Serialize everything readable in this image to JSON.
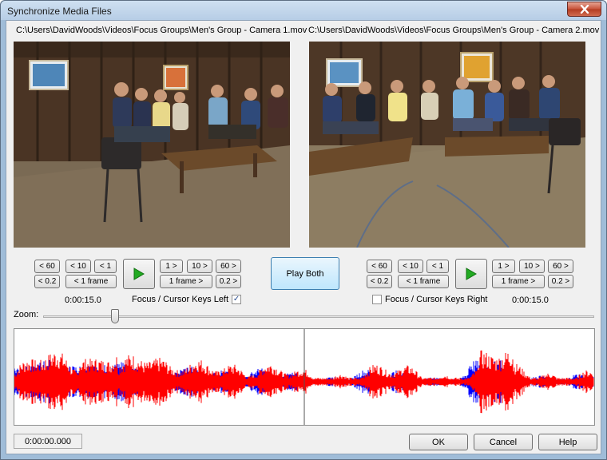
{
  "window": {
    "title": "Synchronize Media Files"
  },
  "left": {
    "path": "C:\\Users\\DavidWoods\\Videos\\Focus Groups\\Men's Group - Camera 1.mov",
    "buttons": [
      "< 60",
      "< 10",
      "< 1",
      "1 >",
      "10 >",
      "60 >",
      "< 0.2",
      "< 1 frame",
      "1 frame >",
      "0.2 >"
    ],
    "time": "0:00:15.0",
    "focus_label": "Focus / Cursor Keys Left",
    "focus_checked": true
  },
  "right": {
    "path": "C:\\Users\\DavidWoods\\Videos\\Focus Groups\\Men's Group - Camera 2.mov",
    "buttons": [
      "< 60",
      "< 10",
      "< 1",
      "1 >",
      "10 >",
      "60 >",
      "< 0.2",
      "< 1 frame",
      "1 frame >",
      "0.2 >"
    ],
    "time": "0:00:15.0",
    "focus_label": "Focus / Cursor Keys Right",
    "focus_checked": false
  },
  "play_both_label": "Play Both",
  "zoom": {
    "label": "Zoom:",
    "value": 0.13
  },
  "status_time": "0:00:00.000",
  "footer": {
    "ok": "OK",
    "cancel": "Cancel",
    "help": "Help"
  },
  "colors": {
    "waveform_left": "#ff0000",
    "waveform_right": "#0000ff",
    "play": "#22aa22"
  }
}
